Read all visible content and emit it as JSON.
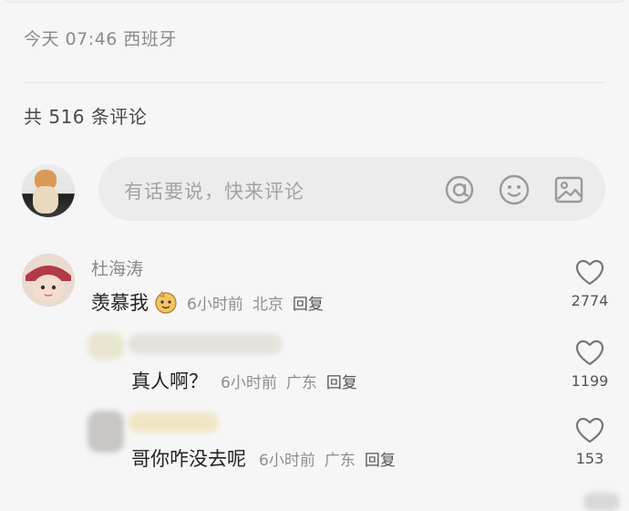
{
  "post": {
    "meta": "今天 07:46 西班牙"
  },
  "comments_header": {
    "count_text": "共 516 条评论"
  },
  "composer": {
    "placeholder": "有话要说，快来评论",
    "icons": [
      "at-icon",
      "emoji-icon",
      "image-icon"
    ]
  },
  "comments": [
    {
      "author": "杜海涛",
      "text": "羡慕我",
      "has_emoji": true,
      "time": "6小时前",
      "location": "北京",
      "reply_label": "回复",
      "likes": "2774"
    },
    {
      "author": "",
      "text": "真人啊？",
      "time": "6小时前",
      "location": "广东",
      "reply_label": "回复",
      "likes": "1199"
    },
    {
      "author": "",
      "text": "哥你咋没去呢",
      "time": "6小时前",
      "location": "广东",
      "reply_label": "回复",
      "likes": "153"
    }
  ],
  "colors": {
    "background": "#f6f6f6",
    "secondary_text": "#8e8e8e",
    "primary_text": "#222222"
  }
}
